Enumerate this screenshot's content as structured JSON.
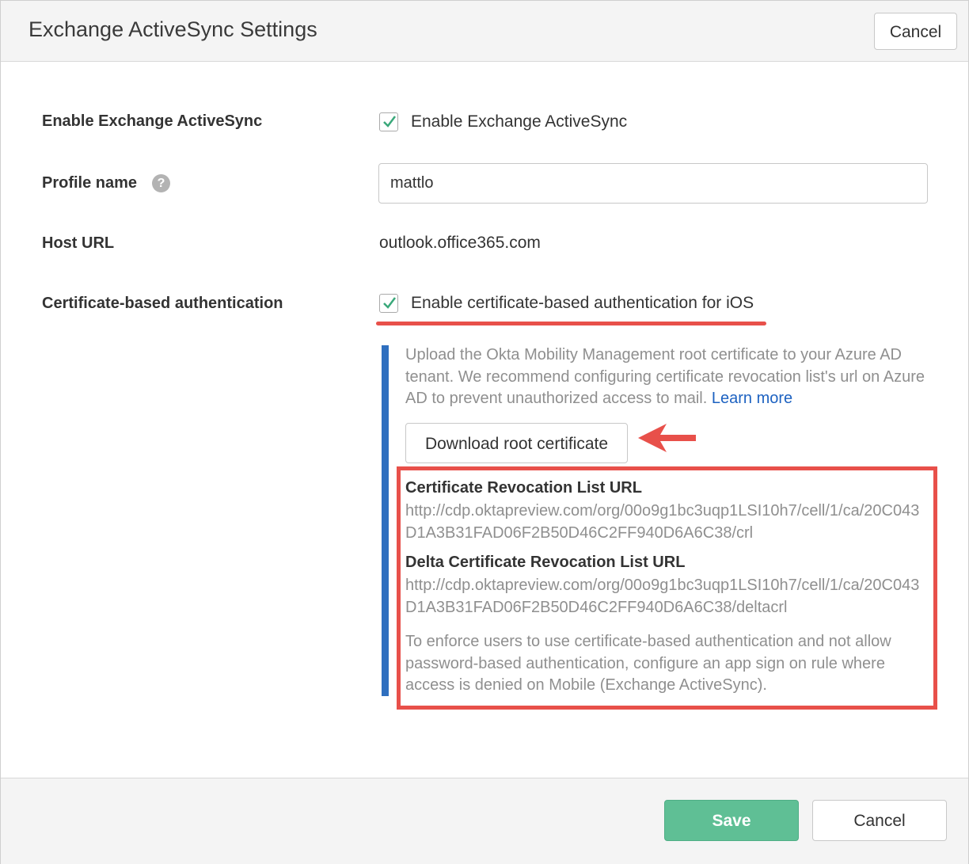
{
  "dialog": {
    "title": "Exchange ActiveSync Settings",
    "header_cancel": "Cancel"
  },
  "form": {
    "enable": {
      "label": "Enable Exchange ActiveSync",
      "checkbox_label": "Enable Exchange ActiveSync",
      "checked": true
    },
    "profile": {
      "label": "Profile name",
      "help_icon": "?",
      "value": "mattlo"
    },
    "host": {
      "label": "Host URL",
      "value": "outlook.office365.com"
    },
    "cert": {
      "label": "Certificate-based authentication",
      "checkbox_label": "Enable certificate-based authentication for iOS",
      "checked": true
    }
  },
  "cert_info": {
    "description": "Upload the Okta Mobility Management root certificate to your Azure AD tenant. We recommend configuring certificate revocation list's url on Azure AD to prevent unauthorized access to mail.",
    "learn_more": "Learn more",
    "download_button": "Download root certificate",
    "crl_title": "Certificate Revocation List URL",
    "crl_url": "http://cdp.oktapreview.com/org/00o9g1bc3uqp1LSI10h7/cell/1/ca/20C043D1A3B31FAD06F2B50D46C2FF940D6A6C38/crl",
    "delta_title": "Delta Certificate Revocation List URL",
    "delta_url": "http://cdp.oktapreview.com/org/00o9g1bc3uqp1LSI10h7/cell/1/ca/20C043D1A3B31FAD06F2B50D46C2FF940D6A6C38/deltacrl",
    "note": "To enforce users to use certificate-based authentication and not allow password-based authentication, configure an app sign on rule where access is denied on Mobile (Exchange ActiveSync)."
  },
  "footer": {
    "save": "Save",
    "cancel": "Cancel"
  },
  "colors": {
    "accent_red": "#e8504a",
    "info_bar_blue": "#2f6fbf",
    "save_green": "#5fbf95",
    "check_green": "#3aa87a",
    "link_blue": "#1d62c1"
  },
  "icons": {
    "checkbox": "check-icon",
    "help": "help-icon",
    "arrow": "arrow-left-icon"
  }
}
